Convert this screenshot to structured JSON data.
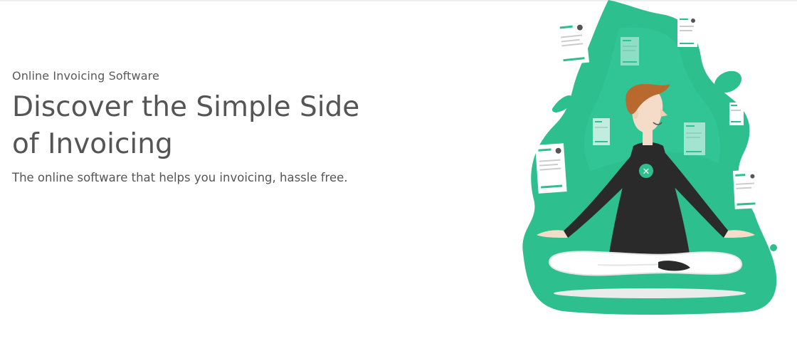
{
  "hero": {
    "eyebrow": "Online Invoicing Software",
    "headline": "Discover the Simple Side of Invoicing",
    "subline": "The online software that helps you invoicing, hassle free."
  },
  "colors": {
    "brand_green": "#2ebf8f",
    "text_gray": "#555555",
    "shirt_black": "#2a2a2a"
  },
  "illustration": {
    "logo_glyph": "✕"
  }
}
